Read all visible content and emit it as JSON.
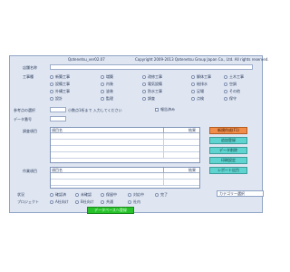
{
  "window": {
    "app_title": "Qotenetsu_ver02.07",
    "copyright": "Copyright 2009-2013 Qotenetsu Group Japan Co., Ltd. All rights reserved."
  },
  "form": {
    "row1_label": "店舗名称",
    "row2_label": "工事種",
    "rating_label": "参考点の選択",
    "rating_hint": "小数点1桁まで 入力してください",
    "rating_checkbox": "報告済み",
    "extra_label": "データ番号",
    "radio_options": [
      [
        "新築工事",
        "増築",
        "改修工事",
        "解体工事",
        "土木工事"
      ],
      [
        "設備工事",
        "内装",
        "電気設備",
        "給排水",
        "空調"
      ],
      [
        "外構工事",
        "塗装",
        "防水工事",
        "足場",
        "その他"
      ],
      [
        "設計",
        "監理",
        "調査",
        "点検",
        "保守"
      ]
    ]
  },
  "table1": {
    "label": "調査項目",
    "col1": "項目名",
    "col2": "結果"
  },
  "table2": {
    "label": "作業項目",
    "col1": "項目名",
    "col2": "結果"
  },
  "side_buttons": [
    "新規作成(F1)",
    "追加登録",
    "データ削除",
    "印刷設定",
    "レポート出力"
  ],
  "bottom": {
    "row1_label": "状況",
    "row1_options": [
      "確認済",
      "未確認",
      "保留中",
      "対応中",
      "完了"
    ],
    "row2_label": "プロジェクト",
    "row2_options": [
      "A社向け",
      "B社向け",
      "共通",
      "社内"
    ],
    "submit_button": "データベースへ登録",
    "select_value": "カテゴリー選択",
    "colors": {
      "button_green": "#27c22a",
      "button_cyan": "#5fd3cf",
      "button_orange": "#f08d4a"
    }
  }
}
